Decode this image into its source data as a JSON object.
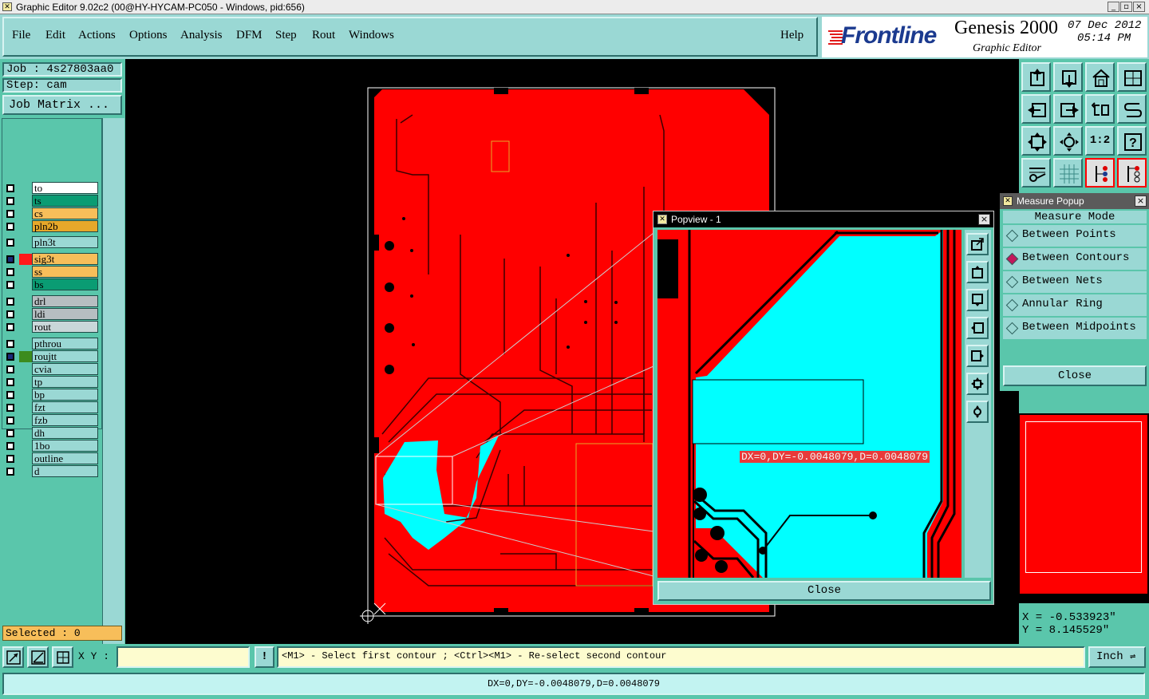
{
  "window": {
    "title": "Graphic Editor 9.02c2 (00@HY-HYCAM-PC050 - Windows, pid:656)",
    "minimize": "_",
    "maximize": "▫",
    "close": "×"
  },
  "menu": {
    "items": [
      "File",
      "Edit",
      "Actions",
      "Options",
      "Analysis",
      "DFM",
      "Step",
      "Rout",
      "Windows"
    ],
    "help": "Help"
  },
  "logo": {
    "brand": "Frontline",
    "product": "Genesis 2000",
    "subtitle": "Graphic Editor",
    "date": "07 Dec 2012",
    "time": "05:14 PM"
  },
  "job": {
    "job_label": "Job : 4s27803aa0",
    "step_label": "Step: cam",
    "matrix_button": "Job Matrix ..."
  },
  "layers": {
    "group1": [
      {
        "name": "to",
        "color": "#ffffff",
        "mark": ""
      },
      {
        "name": "ts",
        "color": "#0a9c73",
        "mark": ""
      },
      {
        "name": "cs",
        "color": "#f7be5a",
        "mark": ""
      },
      {
        "name": "pln2b",
        "color": "#e6a82a",
        "mark": ""
      }
    ],
    "group2": [
      {
        "name": "pln3t",
        "color": "#9ad8d4",
        "mark": ""
      }
    ],
    "group3": [
      {
        "name": "sig3t",
        "color": "#f7be5a",
        "mark": "#ff1a1a"
      },
      {
        "name": "ss",
        "color": "#f7be5a",
        "mark": ""
      },
      {
        "name": "bs",
        "color": "#0a9c73",
        "mark": ""
      }
    ],
    "group4": [
      {
        "name": "drl",
        "color": "#b6bec1",
        "mark": ""
      },
      {
        "name": "ldi",
        "color": "#b6bec1",
        "mark": ""
      },
      {
        "name": "rout",
        "color": "#c9d7d9",
        "mark": ""
      }
    ],
    "group5": [
      {
        "name": "pthrou",
        "color": "#9ad8d4",
        "mark": ""
      },
      {
        "name": "roujtt",
        "color": "#9ad8d4",
        "mark": "#3c8c1e"
      },
      {
        "name": "cvia",
        "color": "#9ad8d4",
        "mark": ""
      },
      {
        "name": "tp",
        "color": "#9ad8d4",
        "mark": ""
      },
      {
        "name": "bp",
        "color": "#9ad8d4",
        "mark": ""
      },
      {
        "name": "fzt",
        "color": "#9ad8d4",
        "mark": ""
      },
      {
        "name": "fzb",
        "color": "#9ad8d4",
        "mark": ""
      },
      {
        "name": "dh",
        "color": "#9ad8d4",
        "mark": ""
      },
      {
        "name": "1bo",
        "color": "#9ad8d4",
        "mark": ""
      },
      {
        "name": "outline",
        "color": "#9ad8d4",
        "mark": ""
      },
      {
        "name": "d",
        "color": "#9ad8d4",
        "mark": ""
      }
    ]
  },
  "selected_label": "Selected : 0",
  "popview": {
    "title": "Popview - 1",
    "measurement": "DX=0,DY=-0.0048079,D=0.0048079",
    "close_button": "Close"
  },
  "measure": {
    "title": "Measure Popup",
    "heading": "Measure Mode",
    "options": [
      "Between Points",
      "Between Contours",
      "Between Nets",
      "Annular Ring",
      "Between Midpoints"
    ],
    "selected_index": 1,
    "close_button": "Close"
  },
  "toolbox": {
    "ratio_label": "1:2",
    "help_label": "?"
  },
  "coords": {
    "x": "X = -0.533923\"",
    "y": "Y = 8.145529\""
  },
  "command": {
    "xy_label": "X Y :",
    "xy_value": "",
    "info_icon": "!",
    "prompt": "<M1> - Select first contour ; <Ctrl><M1> - Re-select second contour",
    "units": "Inch"
  },
  "status": {
    "text": "DX=0,DY=-0.0048079,D=0.0048079"
  },
  "colors": {
    "panel": "#5ac6ab",
    "panel_light": "#9ad8d4",
    "board": "#ff0000",
    "copper_fill": "#00ffff",
    "canvas": "#000000"
  }
}
